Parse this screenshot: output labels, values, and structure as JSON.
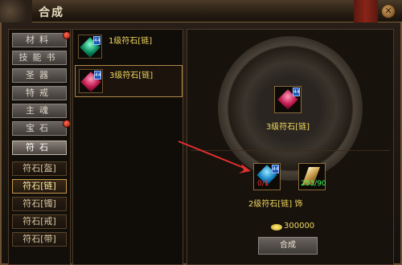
{
  "window": {
    "title": "合成",
    "close_glyph": "✕"
  },
  "sidebar": {
    "tabs": [
      {
        "label": "材料",
        "dot": true
      },
      {
        "label": "技能书",
        "dot": false
      },
      {
        "label": "圣器",
        "dot": false
      },
      {
        "label": "特戒",
        "dot": false
      },
      {
        "label": "主魂",
        "dot": false
      },
      {
        "label": "宝石",
        "dot": true
      },
      {
        "label": "符石",
        "dot": false,
        "selected": true
      }
    ],
    "subs": [
      {
        "label": "符石[盔]"
      },
      {
        "label": "符石[链]",
        "selected": true
      },
      {
        "label": "符石[镯]"
      },
      {
        "label": "符石[戒]"
      },
      {
        "label": "符石[带]"
      }
    ]
  },
  "list": {
    "items": [
      {
        "label": "1级符石[链]",
        "badge": "44",
        "gem": "green"
      },
      {
        "label": "3级符石[链]",
        "badge": "44",
        "gem": "red",
        "selected": true
      }
    ]
  },
  "craft": {
    "result_label": "3级符石[链]",
    "result_badge": "44",
    "material1": {
      "qty": "0/1",
      "badge": "44"
    },
    "material2": {
      "qty": "253/90"
    },
    "materials_label": "2级符石[链]  饰",
    "cost": "300000",
    "craft_button": "合成"
  },
  "colors": {
    "accent": "#f0d860",
    "arrow": "#e03030"
  }
}
